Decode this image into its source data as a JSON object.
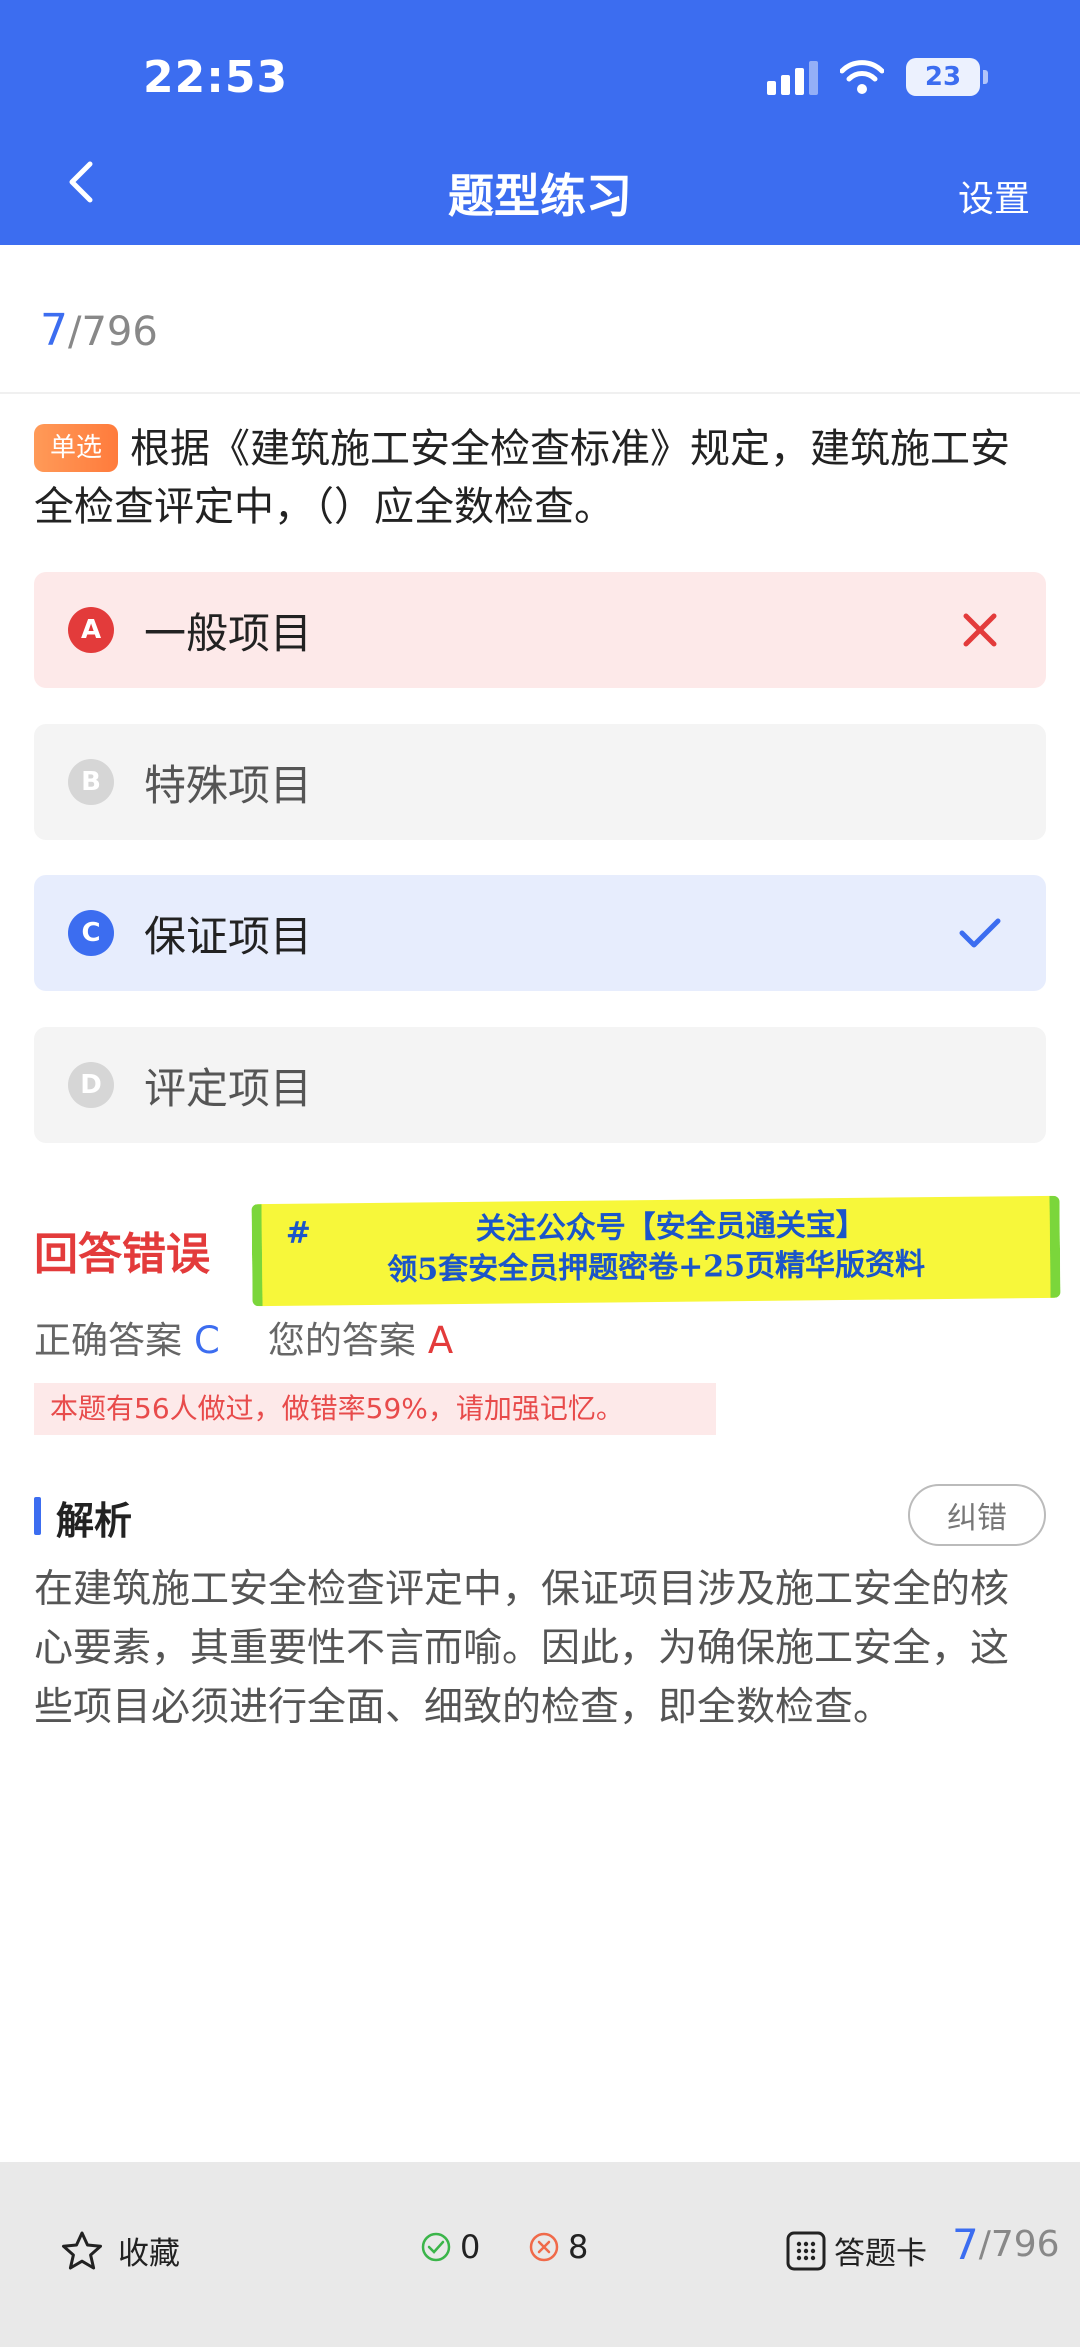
{
  "status_bar": {
    "time": "22:53",
    "battery": "23"
  },
  "nav": {
    "title": "题型练习",
    "settings_label": "设置"
  },
  "progress": {
    "current": "7",
    "total": "/796"
  },
  "question": {
    "type_tag": "单选",
    "text": "根据《建筑施工安全检查标准》规定，建筑施工安全检查评定中，（）应全数检查。"
  },
  "options": [
    {
      "letter": "A",
      "text": "一般项目",
      "state": "wrong"
    },
    {
      "letter": "B",
      "text": "特殊项目",
      "state": "plain"
    },
    {
      "letter": "C",
      "text": "保证项目",
      "state": "correct"
    },
    {
      "letter": "D",
      "text": "评定项目",
      "state": "plain"
    }
  ],
  "result": {
    "title": "回答错误",
    "correct_label": "正确答案",
    "correct_value": "C",
    "your_label": "您的答案",
    "your_value": "A",
    "stats": "本题有56人做过，做错率59%，请加强记忆。"
  },
  "banner": {
    "hash": "#",
    "line1": "关注公众号【安全员通关宝】",
    "line2": "领5套安全员押题密卷+25页精华版资料"
  },
  "analysis": {
    "title": "解析",
    "report_label": "纠错",
    "text": "在建筑施工安全检查评定中，保证项目涉及施工安全的核心要素，其重要性不言而喻。因此，为确保施工安全，这些项目必须进行全面、细致的检查，即全数检查。"
  },
  "bottom_bar": {
    "favorite_label": "收藏",
    "correct_count": "0",
    "wrong_count": "8",
    "answer_card_label": "答题卡",
    "progress_current": "7",
    "progress_total": "/796"
  },
  "colors": {
    "primary": "#3c6df0",
    "error": "#e33b3b",
    "tag": "#ff7b3c",
    "banner": "#f7f73a"
  }
}
